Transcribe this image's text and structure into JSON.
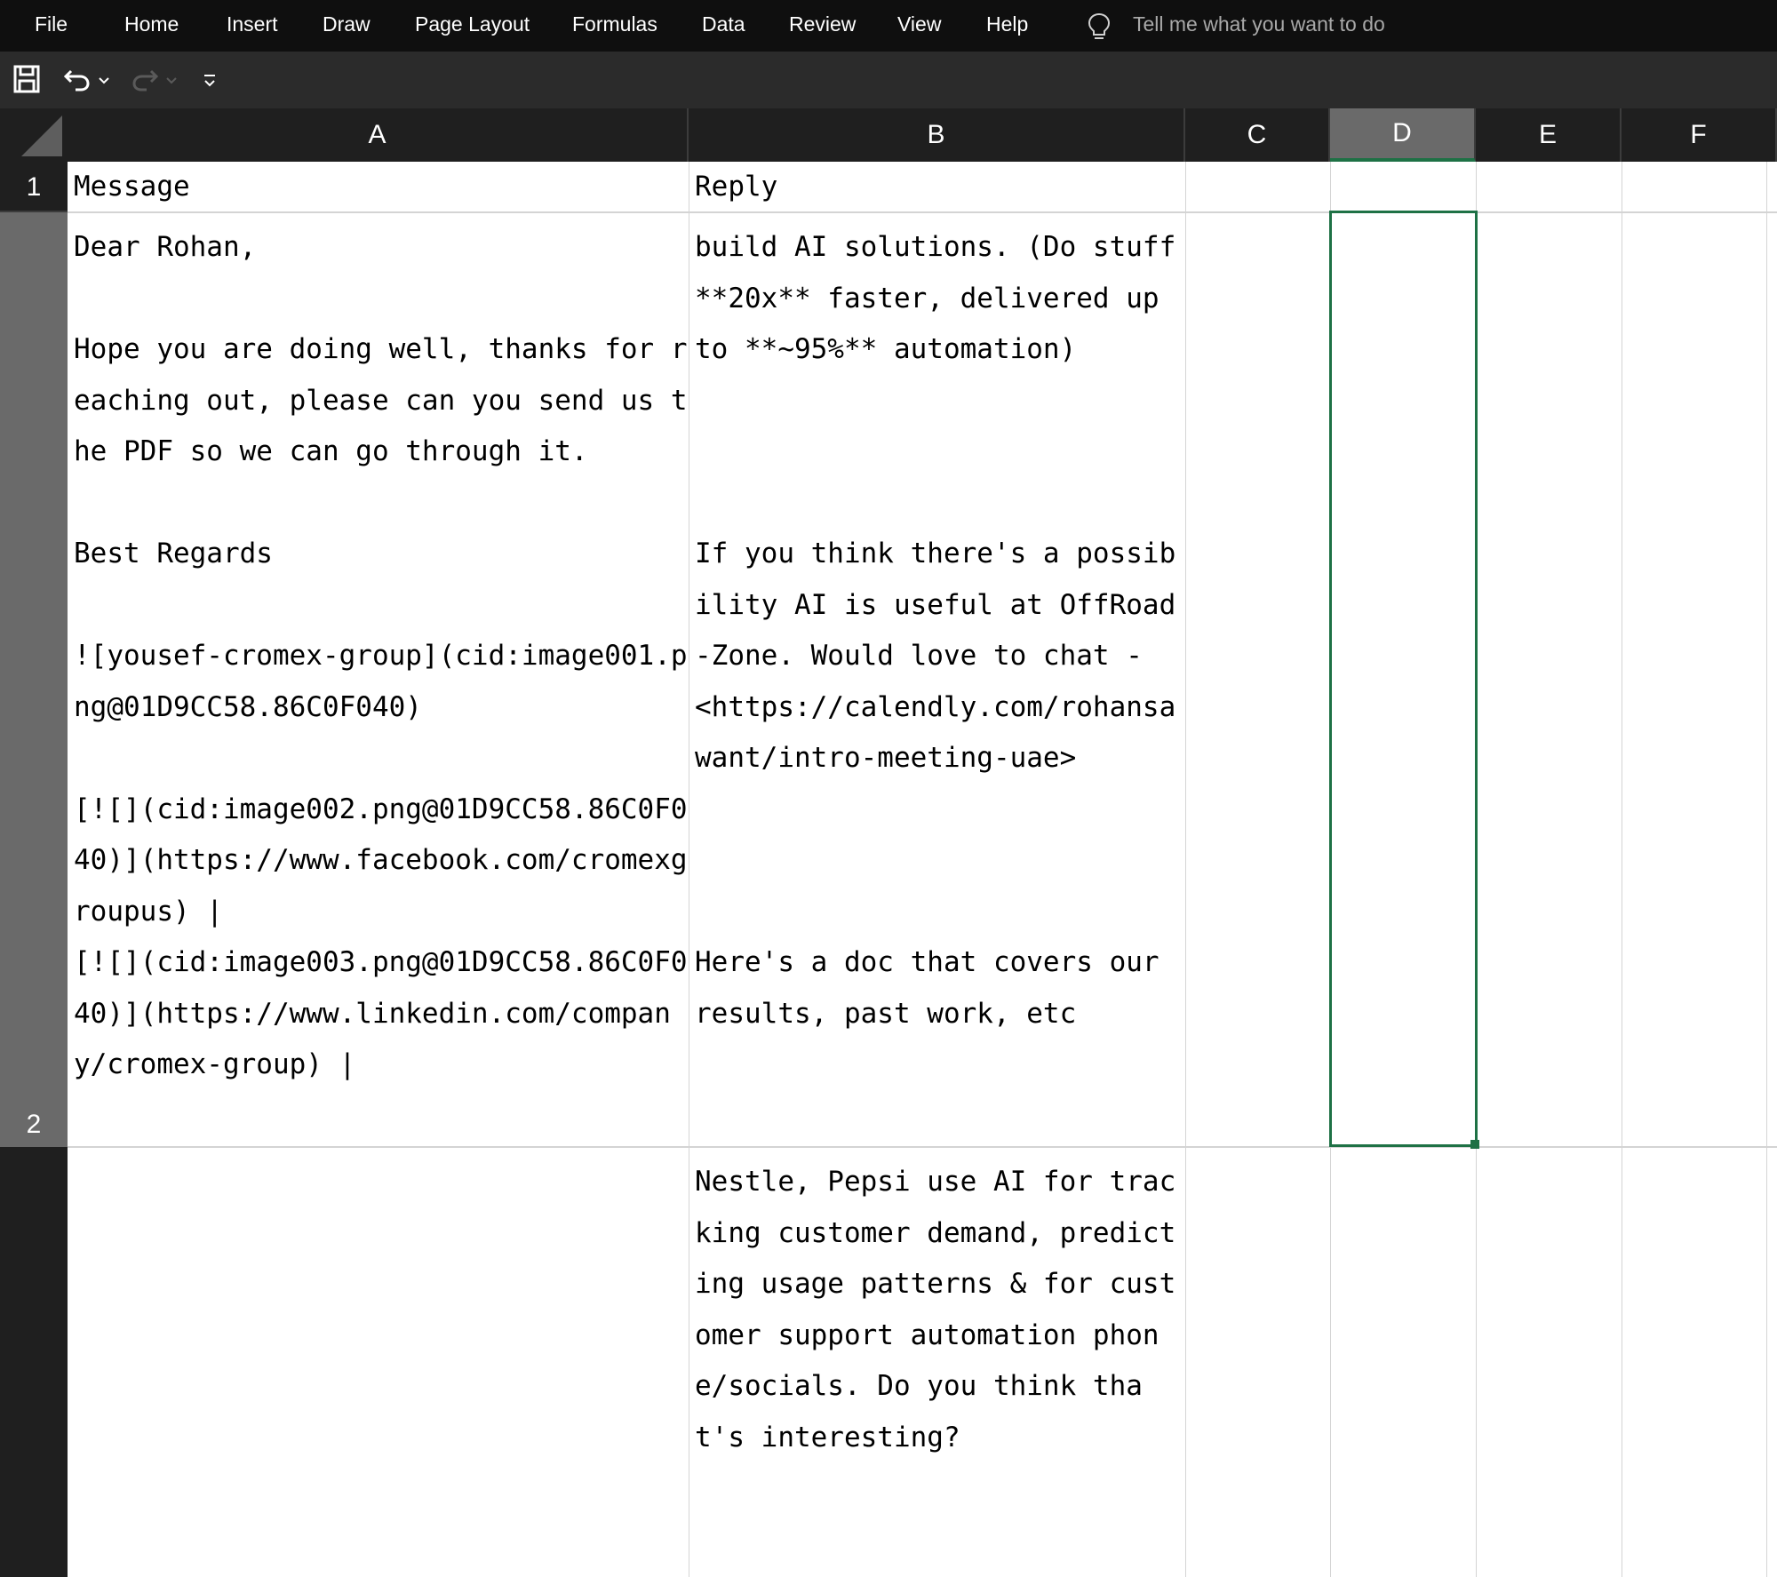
{
  "menu": {
    "file": "File",
    "home": "Home",
    "insert": "Insert",
    "draw": "Draw",
    "page_layout": "Page Layout",
    "formulas": "Formulas",
    "data": "Data",
    "review": "Review",
    "view": "View",
    "help": "Help",
    "tell_me": "Tell me what you want to do"
  },
  "toolbar": {
    "save_icon": "save-icon",
    "undo_icon": "undo-icon",
    "redo_icon": "redo-icon",
    "customize_icon": "customize-qat-icon"
  },
  "columns": [
    "A",
    "B",
    "C",
    "D",
    "E",
    "F"
  ],
  "active_column": "D",
  "rows": [
    "1",
    "2"
  ],
  "cells": {
    "A1": "Message",
    "B1": "Reply",
    "A2": "Dear Rohan,\n\nHope you are doing well, thanks for reaching out, please can you send us the PDF so we can go through it.\n\nBest Regards\n\n![yousef-cromex-group](cid:image001.png@01D9CC58.86C0F040)\n\n[![](cid:image002.png@01D9CC58.86C0F040)](https://www.facebook.com/cromexgroupus) |\n[![](cid:image003.png@01D9CC58.86C0F040)](https://www.linkedin.com/company/cromex-group) |",
    "B2": "build AI solutions. (Do stuff **20x** faster, delivered up to **~95%** automation)\n\n\n\nIf you think there's a possibility AI is useful at OffRoad-Zone. Would love to chat -\n<https://calendly.com/rohansawant/intro-meeting-uae>\n\n\n\nHere's a doc that covers our results, past work, etc",
    "B3": "Nestle, Pepsi use AI for tracking customer demand, predicting usage patterns & for customer support automation phone/socials. Do you think that's interesting?"
  },
  "colors": {
    "menubar_bg": "#0f0f0f",
    "selection": "#1e7145",
    "active_header": "#6a6a6a"
  }
}
